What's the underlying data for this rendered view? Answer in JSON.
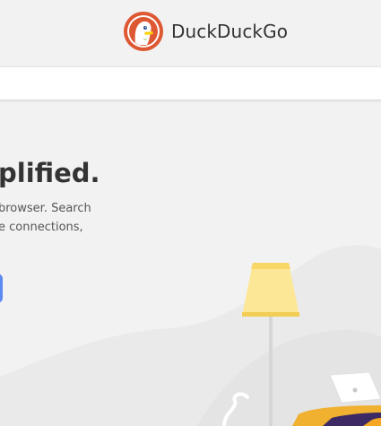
{
  "header": {
    "brand_name": "DuckDuckGo",
    "logo_icon": "duck-logo-icon"
  },
  "search": {
    "placeholder": "",
    "value": ""
  },
  "hero": {
    "title": "plified.",
    "description_lines": [
      "browser. Search",
      "e connections,"
    ]
  },
  "cta": {
    "label": ""
  },
  "colors": {
    "brand_orange": "#de5833",
    "cta_blue": "#5b8af5",
    "background": "#f2f2f2",
    "lamp_yellow": "#fbe796"
  },
  "illustration": {
    "icons": [
      "floor-lamp-icon",
      "laptop-icon",
      "cushion-icon"
    ]
  }
}
